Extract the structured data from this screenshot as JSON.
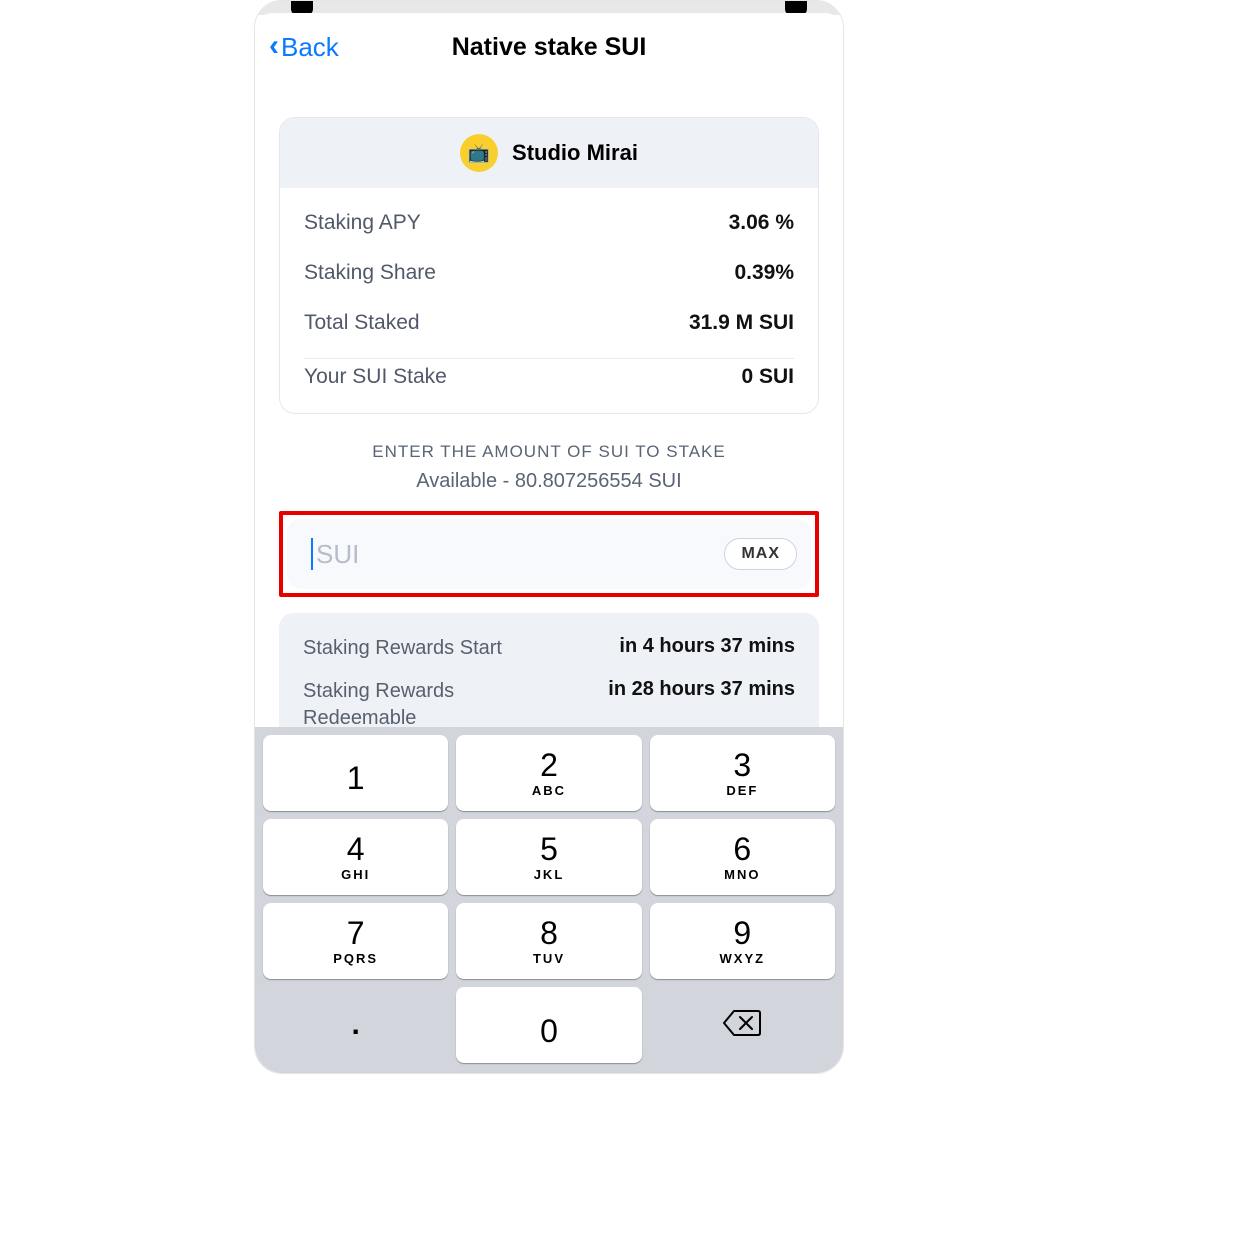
{
  "nav": {
    "back_label": "Back",
    "title": "Native stake SUI"
  },
  "validator": {
    "name": "Studio Mirai",
    "icon_emoji": "📺"
  },
  "stats": {
    "apy_label": "Staking APY",
    "apy_value": "3.06 %",
    "share_label": "Staking Share",
    "share_value": "0.39%",
    "total_label": "Total Staked",
    "total_value": "31.9 M SUI",
    "your_label": "Your SUI Stake",
    "your_value": "0 SUI"
  },
  "prompt": {
    "line1": "ENTER THE AMOUNT OF SUI TO STAKE",
    "line2": "Available - 80.807256554 SUI"
  },
  "input": {
    "placeholder": "SUI",
    "max_label": "MAX"
  },
  "info": {
    "start_label": "Staking Rewards Start",
    "start_value": "in 4 hours 37 mins",
    "redeem_label": "Staking Rewards Redeemable",
    "redeem_value": "in 28 hours 37 mins"
  },
  "keypad": {
    "k1": {
      "n": "1",
      "s": ""
    },
    "k2": {
      "n": "2",
      "s": "ABC"
    },
    "k3": {
      "n": "3",
      "s": "DEF"
    },
    "k4": {
      "n": "4",
      "s": "GHI"
    },
    "k5": {
      "n": "5",
      "s": "JKL"
    },
    "k6": {
      "n": "6",
      "s": "MNO"
    },
    "k7": {
      "n": "7",
      "s": "PQRS"
    },
    "k8": {
      "n": "8",
      "s": "TUV"
    },
    "k9": {
      "n": "9",
      "s": "WXYZ"
    },
    "dot": ".",
    "k0": "0"
  }
}
